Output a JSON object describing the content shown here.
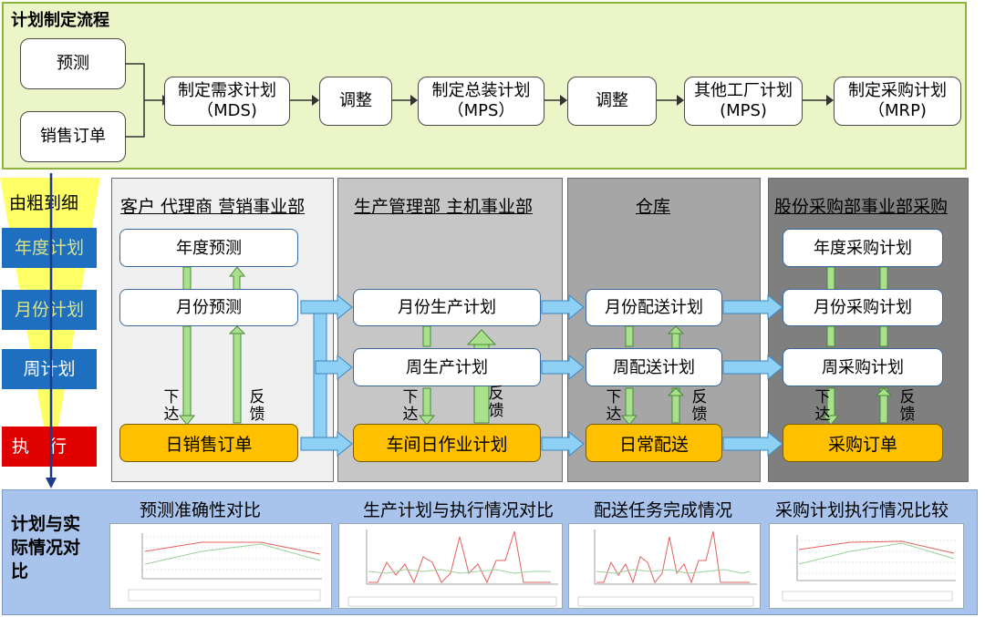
{
  "top": {
    "title": "计划制定流程",
    "inputs": [
      "预测",
      "销售订单"
    ],
    "steps": [
      "制定需求计划（MDS)",
      "调整",
      "制定总装计划（MPS）",
      "调整",
      "其他工厂计划(MPS)",
      "制定采购计划（MRP)"
    ]
  },
  "levels": {
    "header": "由粗到细",
    "items": [
      "年度计划",
      "月份计划",
      "周计划",
      "执行"
    ],
    "colors": {
      "blue": "#1f6fc0",
      "red": "#e00000",
      "yellow": "#ffff66"
    }
  },
  "columns": [
    {
      "head": "客户  代理商  营销事业部",
      "boxes": [
        "年度预测",
        "月份预测"
      ],
      "order": "日销售订单",
      "down": "下达",
      "up": "反馈"
    },
    {
      "head": "生产管理部 主机事业部",
      "boxes": [
        "月份生产计划",
        "周生产计划"
      ],
      "order": "车间日作业计划",
      "down": "下达",
      "up": "反馈"
    },
    {
      "head": "仓库",
      "boxes": [
        "月份配送计划",
        "周配送计划"
      ],
      "order": "日常配送",
      "down": "下达",
      "up": "反馈"
    },
    {
      "head": "股份采购部事业部采购",
      "boxes": [
        "年度采购计划",
        "月份采购计划",
        "周采购计划"
      ],
      "order": "采购订单",
      "down": "下达",
      "up": "反馈"
    }
  ],
  "bottom": {
    "label": "计划与实际情况对比",
    "titles": [
      "预测准确性对比",
      "生产计划与执行情况对比",
      "配送任务完成情况",
      "采购计划执行情况比较"
    ]
  },
  "colors": {
    "panel_green": "#ebf5c8",
    "panel_blue": "#a9c4ec",
    "orange": "#ffc000",
    "arrow": "#8fd0f5"
  }
}
